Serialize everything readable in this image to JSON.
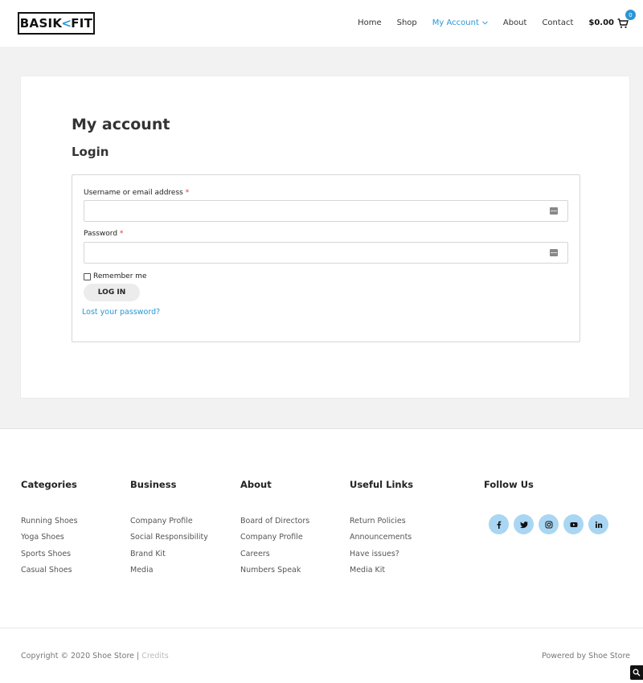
{
  "brand": {
    "logo_left": "BASIK",
    "logo_mark": "<",
    "logo_right": "FIT",
    "accent": "#2b96d4"
  },
  "nav": {
    "items": [
      {
        "label": "Home",
        "active": false
      },
      {
        "label": "Shop",
        "active": false
      },
      {
        "label": "My Account",
        "active": true,
        "icon": "chevron-down-icon"
      },
      {
        "label": "About",
        "active": false
      },
      {
        "label": "Contact",
        "active": false
      }
    ],
    "cart": {
      "total": "$0.00",
      "count": "0",
      "icon": "cart-icon"
    }
  },
  "page": {
    "title": "My account",
    "subtitle": "Login",
    "form": {
      "username_label": "Username or email address",
      "password_label": "Password",
      "required_marker": "*",
      "username_value": "",
      "password_value": "",
      "field_icon": "password-manager-icon",
      "remember_label": "Remember me",
      "remember_checked": false,
      "login_button": "LOG IN",
      "lost_password": "Lost your password?"
    }
  },
  "footer": {
    "columns": [
      {
        "title": "Categories",
        "links": [
          "Running Shoes",
          "Yoga Shoes",
          "Sports Shoes",
          "Casual Shoes"
        ]
      },
      {
        "title": "Business",
        "links": [
          "Company Profile",
          "Social Responsibility",
          "Brand Kit",
          "Media"
        ]
      },
      {
        "title": "About",
        "links": [
          "Board of Directors",
          "Company Profile",
          "Careers",
          "Numbers Speak"
        ]
      },
      {
        "title": "Useful Links",
        "links": [
          "Return Policies",
          "Announcements",
          "Have issues?",
          "Media Kit"
        ]
      }
    ],
    "follow": {
      "title": "Follow Us",
      "icons": [
        "facebook-icon",
        "twitter-icon",
        "instagram-icon",
        "youtube-icon",
        "linkedin-icon"
      ]
    },
    "copyright": "Copyright © 2020 Shoe Store",
    "separator": "|",
    "credits": "Credits",
    "powered": "Powered by Shoe Store"
  }
}
